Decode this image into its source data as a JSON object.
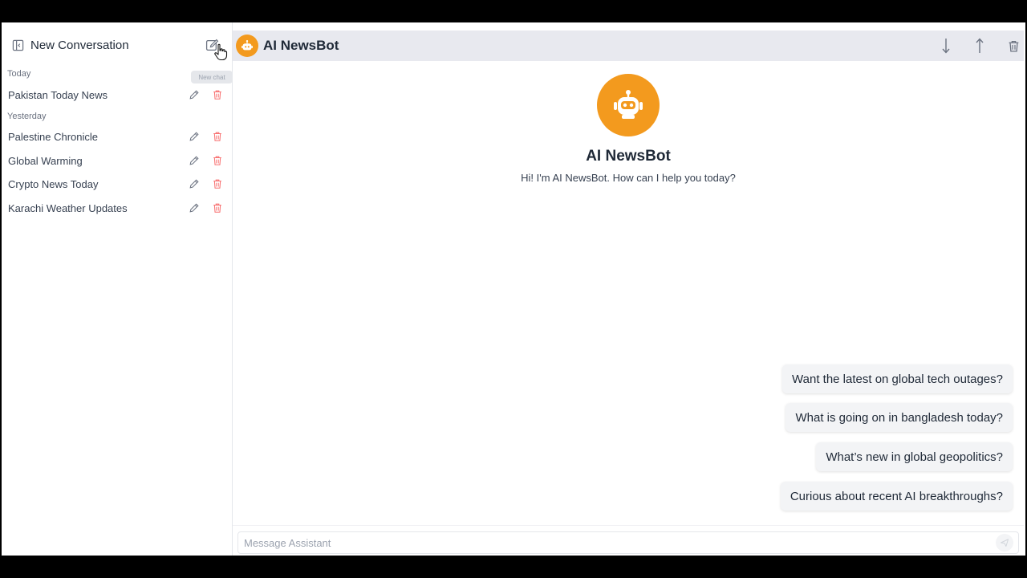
{
  "sidebar": {
    "title": "New Conversation",
    "tooltip": "New chat",
    "groups": {
      "today": "Today",
      "yesterday": "Yesterday"
    },
    "items": [
      {
        "label": "Pakistan Today News"
      },
      {
        "label": "Palestine Chronicle"
      },
      {
        "label": "Global Warming"
      },
      {
        "label": "Crypto News Today"
      },
      {
        "label": "Karachi Weather Updates"
      }
    ]
  },
  "topbar": {
    "title": "AI NewsBot"
  },
  "hero": {
    "title": "AI NewsBot",
    "subtitle": "Hi! I'm AI NewsBot. How can I help you today?"
  },
  "suggestions": [
    "Want the latest on global tech outages?",
    "What is going on in bangladesh today?",
    "What’s new in global geopolitics?",
    "Curious about recent AI breakthroughs?"
  ],
  "composer": {
    "placeholder": "Message Assistant"
  },
  "colors": {
    "accent": "#f39a1e",
    "delete": "#f87171",
    "topbar": "#e8e9ef"
  }
}
